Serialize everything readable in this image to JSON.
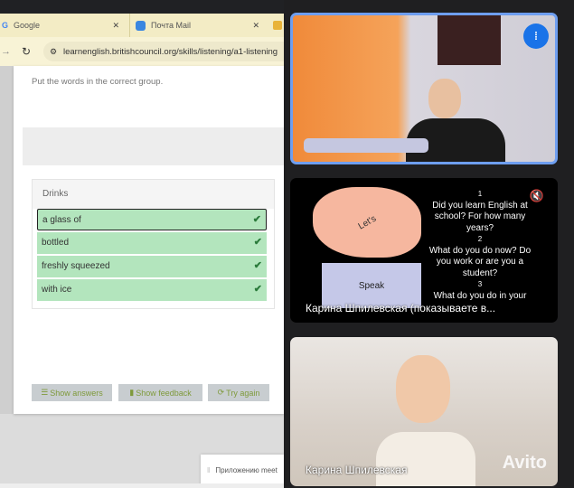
{
  "browser": {
    "tabs": [
      {
        "label": "Google"
      },
      {
        "label": "Почта Mail"
      }
    ],
    "url": "learnenglish.britishcouncil.org/skills/listening/a1-listening"
  },
  "exercise": {
    "instruction": "Put the words in the correct group.",
    "group_title": "Drinks",
    "items": [
      {
        "label": "a glass of",
        "correct": true
      },
      {
        "label": "bottled",
        "correct": true
      },
      {
        "label": "freshly squeezed",
        "correct": true
      },
      {
        "label": "with ice",
        "correct": true
      }
    ],
    "buttons": {
      "show_answers": "Show answers",
      "show_feedback": "Show feedback",
      "try_again": "Try again"
    }
  },
  "toast": "Приложению meet",
  "call": {
    "tile1": {
      "speaking": true,
      "accent": "#6e9ef0"
    },
    "tile2": {
      "muted": true,
      "name": "Карина Шпилевская (показываете в...",
      "slide": {
        "shape1": "Let's",
        "shape2": "Speak",
        "questions": [
          "1",
          "Did you learn English at school? For how many years?",
          "2",
          "What do you do now? Do you work or are you a student?",
          "3",
          "What do you do in your"
        ]
      }
    },
    "tile3": {
      "name": "Карина Шпилевская"
    }
  },
  "watermark": "Avito"
}
